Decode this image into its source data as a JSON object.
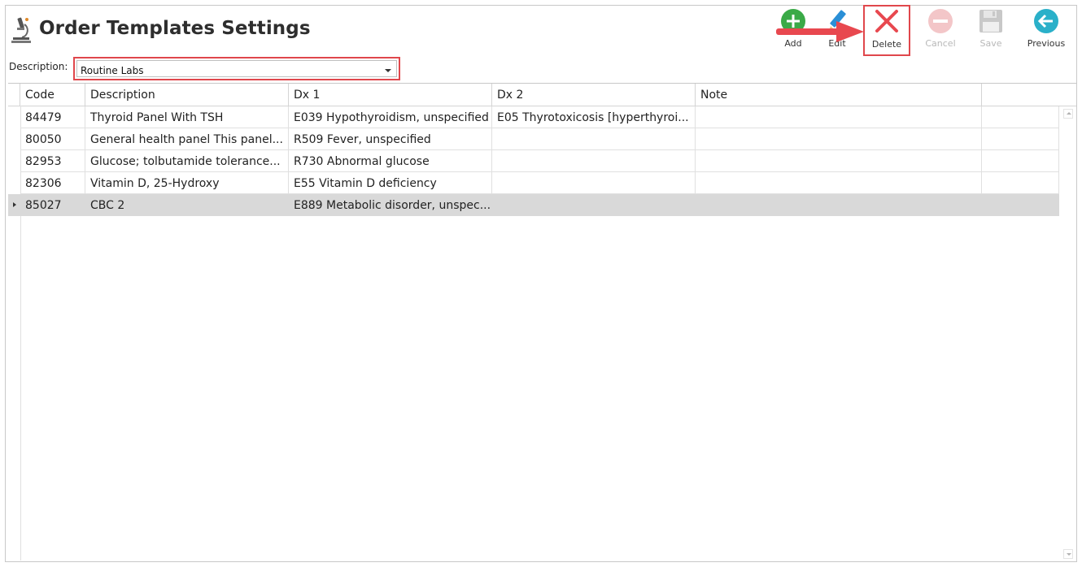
{
  "page": {
    "title": "Order Templates Settings"
  },
  "filter": {
    "label": "Description:",
    "value": "Routine Labs"
  },
  "toolbar": {
    "add": "Add",
    "edit": "Edit",
    "delete": "Delete",
    "cancel": "Cancel",
    "save": "Save",
    "previous": "Previous"
  },
  "colors": {
    "highlight": "#e0474c",
    "add": "#3aaa47",
    "edit": "#2a8fd6",
    "delete": "#e8484f",
    "previous": "#2ab0c9",
    "disabled": "#c8c8c8"
  },
  "grid": {
    "columns": [
      "Code",
      "Description",
      "Dx 1",
      "Dx 2",
      "Note"
    ],
    "rows": [
      {
        "code": "84479",
        "description": "Thyroid Panel With TSH",
        "dx1": "E039 Hypothyroidism, unspecified",
        "dx2": "E05 Thyrotoxicosis [hyperthyroi...",
        "note": ""
      },
      {
        "code": "80050",
        "description": "General health panel This panel...",
        "dx1": "R509 Fever, unspecified",
        "dx2": "",
        "note": ""
      },
      {
        "code": "82953",
        "description": "Glucose; tolbutamide tolerance...",
        "dx1": "R730 Abnormal glucose",
        "dx2": "",
        "note": ""
      },
      {
        "code": "82306",
        "description": "Vitamin D, 25-Hydroxy",
        "dx1": "E55 Vitamin D deficiency",
        "dx2": "",
        "note": ""
      },
      {
        "code": "85027",
        "description": "CBC 2",
        "dx1": "E889 Metabolic disorder, unspec...",
        "dx2": "",
        "note": ""
      }
    ],
    "selected_row": 4
  }
}
